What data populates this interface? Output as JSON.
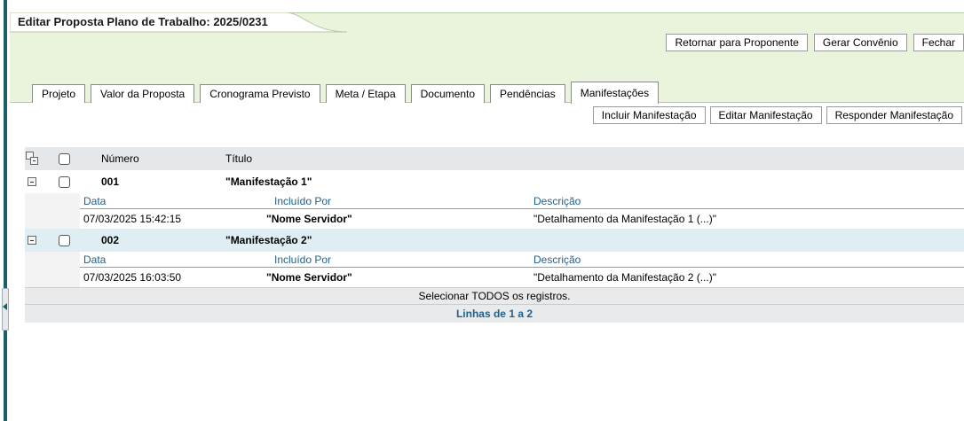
{
  "header": {
    "title": "Editar Proposta Plano de Trabalho: 2025/0231",
    "actions": {
      "retornar": "Retornar para Proponente",
      "gerar": "Gerar Convênio",
      "fechar": "Fechar"
    }
  },
  "tabs": [
    {
      "label": "Projeto"
    },
    {
      "label": "Valor da Proposta"
    },
    {
      "label": "Cronograma Previsto"
    },
    {
      "label": "Meta / Etapa"
    },
    {
      "label": "Documento"
    },
    {
      "label": "Pendências"
    },
    {
      "label": "Manifestações"
    }
  ],
  "subactions": {
    "incluir": "Incluir Manifestação",
    "editar": "Editar Manifestação",
    "responder": "Responder Manifestação"
  },
  "table": {
    "columns": {
      "numero": "Número",
      "titulo": "Título"
    },
    "detail_columns": {
      "data": "Data",
      "incluido": "Incluído Por",
      "descricao": "Descrição"
    },
    "rows": [
      {
        "numero": "001",
        "titulo": "\"Manifestação 1\"",
        "data": "07/03/2025 15:42:15",
        "incluido": "\"Nome Servidor\"",
        "descricao": "\"Detalhamento da Manifestação 1 (...)\""
      },
      {
        "numero": "002",
        "titulo": "\"Manifestação 2\"",
        "data": "07/03/2025 16:03:50",
        "incluido": "\"Nome Servidor\"",
        "descricao": "\"Detalhamento da Manifestação 2 (...)\""
      }
    ],
    "select_all": "Selecionar TODOS os registros.",
    "pagination": "Linhas de 1 a 2"
  },
  "colors": {
    "header_bg": "#eaf4dd",
    "accent": "#1b5e6b",
    "link_blue": "#1f5f8b"
  }
}
